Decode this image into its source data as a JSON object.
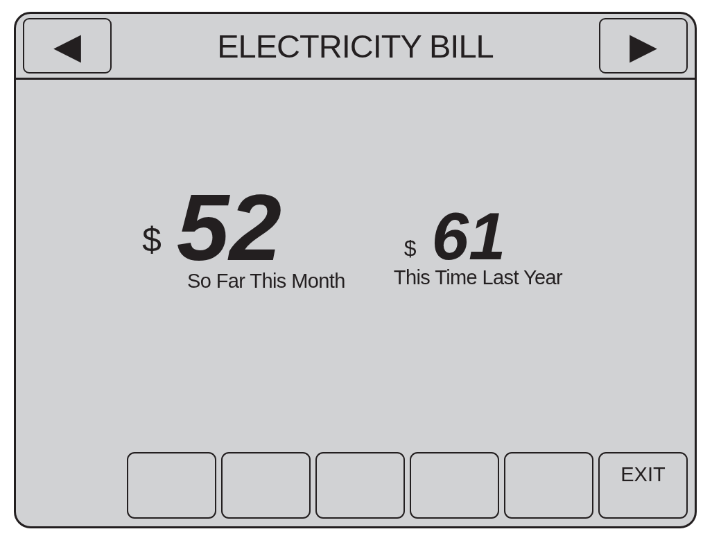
{
  "header": {
    "title": "ELECTRICITY BILL",
    "prev_button": "◀",
    "next_button": "▶"
  },
  "readings": [
    {
      "kind": "primary",
      "currency": "$",
      "amount": "52",
      "label": "So Far This Month"
    },
    {
      "kind": "secondary",
      "currency": "$",
      "amount": "61",
      "label": "This Time Last Year"
    }
  ],
  "softkeys": [
    {
      "kind": "blank"
    },
    {
      "kind": "blank"
    },
    {
      "kind": "blank"
    },
    {
      "kind": "blank"
    },
    {
      "kind": "blank"
    },
    {
      "kind": "labeled",
      "label": "EXIT"
    }
  ]
}
